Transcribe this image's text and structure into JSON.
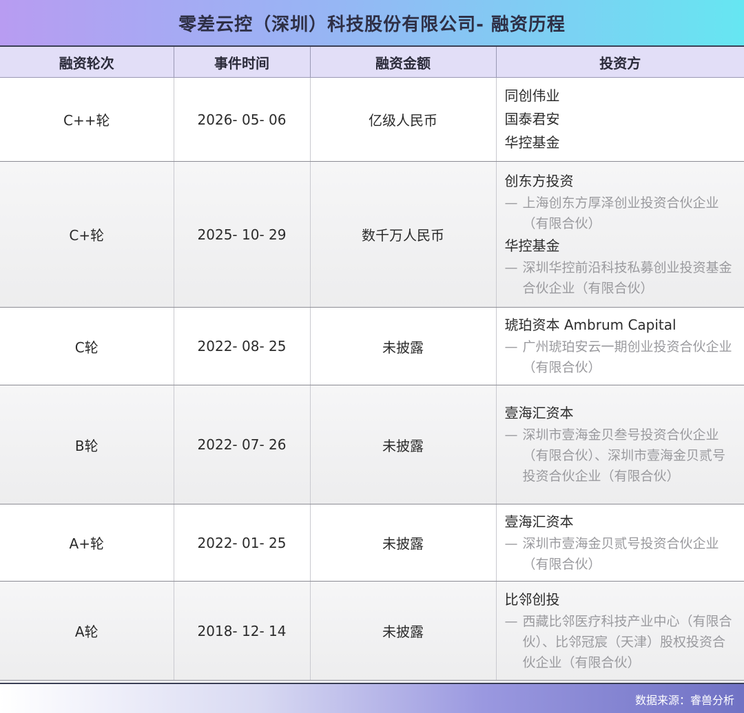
{
  "title": "零差云控（深圳）科技股份有限公司- 融资历程",
  "headers": [
    "融资轮次",
    "事件时间",
    "融资金额",
    "投资方"
  ],
  "rows": [
    {
      "round": "C++轮",
      "date": "2026- 05- 06",
      "amount": "亿级人民币",
      "investors": [
        {
          "name": "同创伟业",
          "entity": ""
        },
        {
          "name": "国泰君安",
          "entity": ""
        },
        {
          "name": "华控基金",
          "entity": ""
        }
      ]
    },
    {
      "round": "C+轮",
      "date": "2025- 10- 29",
      "amount": "数千万人民币",
      "investors": [
        {
          "name": "创东方投资",
          "entity": "上海创东方厚泽创业投资合伙企业（有限合伙）"
        },
        {
          "name": "华控基金",
          "entity": "深圳华控前沿科技私募创业投资基金合伙企业（有限合伙）"
        }
      ]
    },
    {
      "round": "C轮",
      "date": "2022- 08- 25",
      "amount": "未披露",
      "investors": [
        {
          "name": "琥珀资本 Ambrum Capital",
          "entity": "广州琥珀安云一期创业投资合伙企业（有限合伙）"
        }
      ]
    },
    {
      "round": "B轮",
      "date": "2022- 07- 26",
      "amount": "未披露",
      "investors": [
        {
          "name": "壹海汇资本",
          "entity": "深圳市壹海金贝叁号投资合伙企业（有限合伙）、深圳市壹海金贝贰号投资合伙企业（有限合伙）"
        }
      ]
    },
    {
      "round": "A+轮",
      "date": "2022- 01- 25",
      "amount": "未披露",
      "investors": [
        {
          "name": "壹海汇资本",
          "entity": "深圳市壹海金贝贰号投资合伙企业（有限合伙）"
        }
      ]
    },
    {
      "round": "A轮",
      "date": "2018- 12- 14",
      "amount": "未披露",
      "investors": [
        {
          "name": "比邻创投",
          "entity": "西藏比邻医疗科技产业中心（有限合伙）、比邻冠宸（天津）股权投资合伙企业（有限合伙）"
        }
      ]
    }
  ],
  "footer": "数据来源：睿兽分析",
  "dash": "—",
  "colors": {
    "title_left": "#b89cf2",
    "title_right": "#66e6f2",
    "header_bg": "#e2def7",
    "entity_text": "#9a9a9e"
  }
}
